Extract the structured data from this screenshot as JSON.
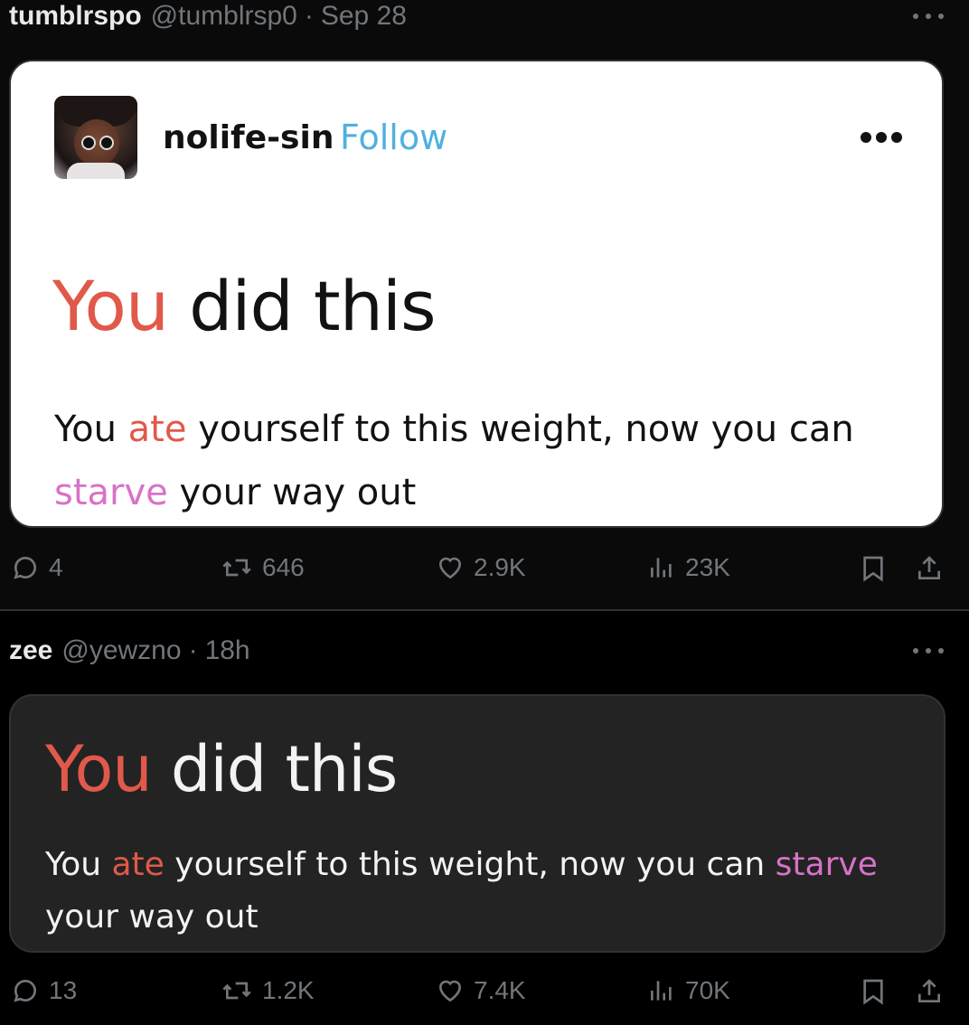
{
  "tweet1": {
    "author_name": "tumblrspo",
    "author_handle": "@tumblrsp0",
    "separator": "·",
    "time": "Sep 28",
    "card": {
      "blog_name": "nolife-sin",
      "follow_label": "Follow",
      "headline_accent": "You",
      "headline_rest": " did this",
      "body_1": "You ",
      "body_accent_1": "ate",
      "body_2": " yourself to this weight, now you can ",
      "body_accent_2": "starve",
      "body_3": " your way out"
    },
    "stats": {
      "replies": "4",
      "retweets": "646",
      "likes": "2.9K",
      "views": "23K"
    }
  },
  "tweet2": {
    "author_name": "zee",
    "author_handle": "@yewzno",
    "separator": "·",
    "time": "18h",
    "card": {
      "headline_accent": "You",
      "headline_rest": " did this",
      "body_1": "You ",
      "body_accent_1": "ate",
      "body_2": " yourself to this weight, now you can ",
      "body_accent_2": "starve",
      "body_3": " your way out"
    },
    "stats": {
      "replies": "13",
      "retweets": "1.2K",
      "likes": "7.4K",
      "views": "70K"
    }
  },
  "icons": {
    "reply": "speech-bubble-icon",
    "retweet": "retweet-arrows-icon",
    "like": "heart-icon",
    "views": "bar-chart-icon",
    "bookmark": "bookmark-icon",
    "share": "share-upload-icon",
    "more": "ellipsis-icon"
  },
  "colors": {
    "accent_red": "#e0594a",
    "accent_pink": "#d872c7",
    "follow_blue": "#4fb0e0",
    "muted": "#71767b"
  }
}
